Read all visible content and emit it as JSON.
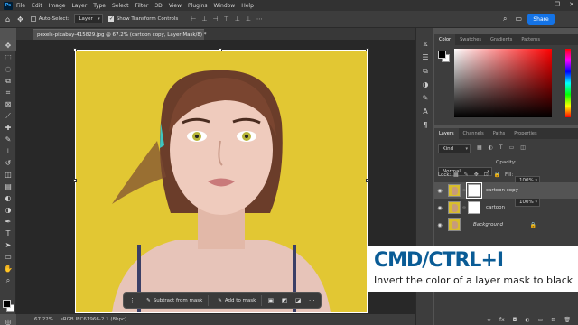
{
  "app": {
    "logo": "Ps",
    "menus": [
      "File",
      "Edit",
      "Image",
      "Layer",
      "Type",
      "Select",
      "Filter",
      "3D",
      "View",
      "Plugins",
      "Window",
      "Help"
    ]
  },
  "options": {
    "auto_select_label": "Auto-Select:",
    "auto_select_value": "Layer",
    "transform_label": "Show Transform Controls",
    "share_label": "Share"
  },
  "document": {
    "tab_title": "pexels-pixabay-415829.jpg @ 67.2% (cartoon copy, Layer Mask/8) *",
    "zoom": "67.22%",
    "color_profile": "sRGB IEC61966-2.1 (8bpc)"
  },
  "taskbar": {
    "subtract_label": "Subtract from mask",
    "add_label": "Add to mask",
    "more_label": "···"
  },
  "color_panel": {
    "tabs": [
      "Color",
      "Swatches",
      "Gradients",
      "Patterns"
    ],
    "active_tab": "Color"
  },
  "layers_panel": {
    "tabs": [
      "Layers",
      "Channels",
      "Paths",
      "Properties"
    ],
    "filter_label": "Kind",
    "blend_mode": "Normal",
    "opacity_label": "Opacity:",
    "opacity_value": "100%",
    "lock_label": "Lock:",
    "fill_label": "Fill:",
    "fill_value": "100%",
    "layers": [
      {
        "name": "cartoon copy",
        "has_mask": true,
        "selected": true
      },
      {
        "name": "cartoon",
        "has_mask": true,
        "selected": false
      },
      {
        "name": "Background",
        "has_mask": false,
        "selected": false,
        "locked": true
      }
    ]
  },
  "caption": {
    "title": "CMD/CTRL+I",
    "subtitle": "Invert the color of a layer mask to black"
  },
  "colors": {
    "accent": "#1473e6",
    "caption_blue": "#0a5c96",
    "canvas_bg": "#e2c733"
  }
}
